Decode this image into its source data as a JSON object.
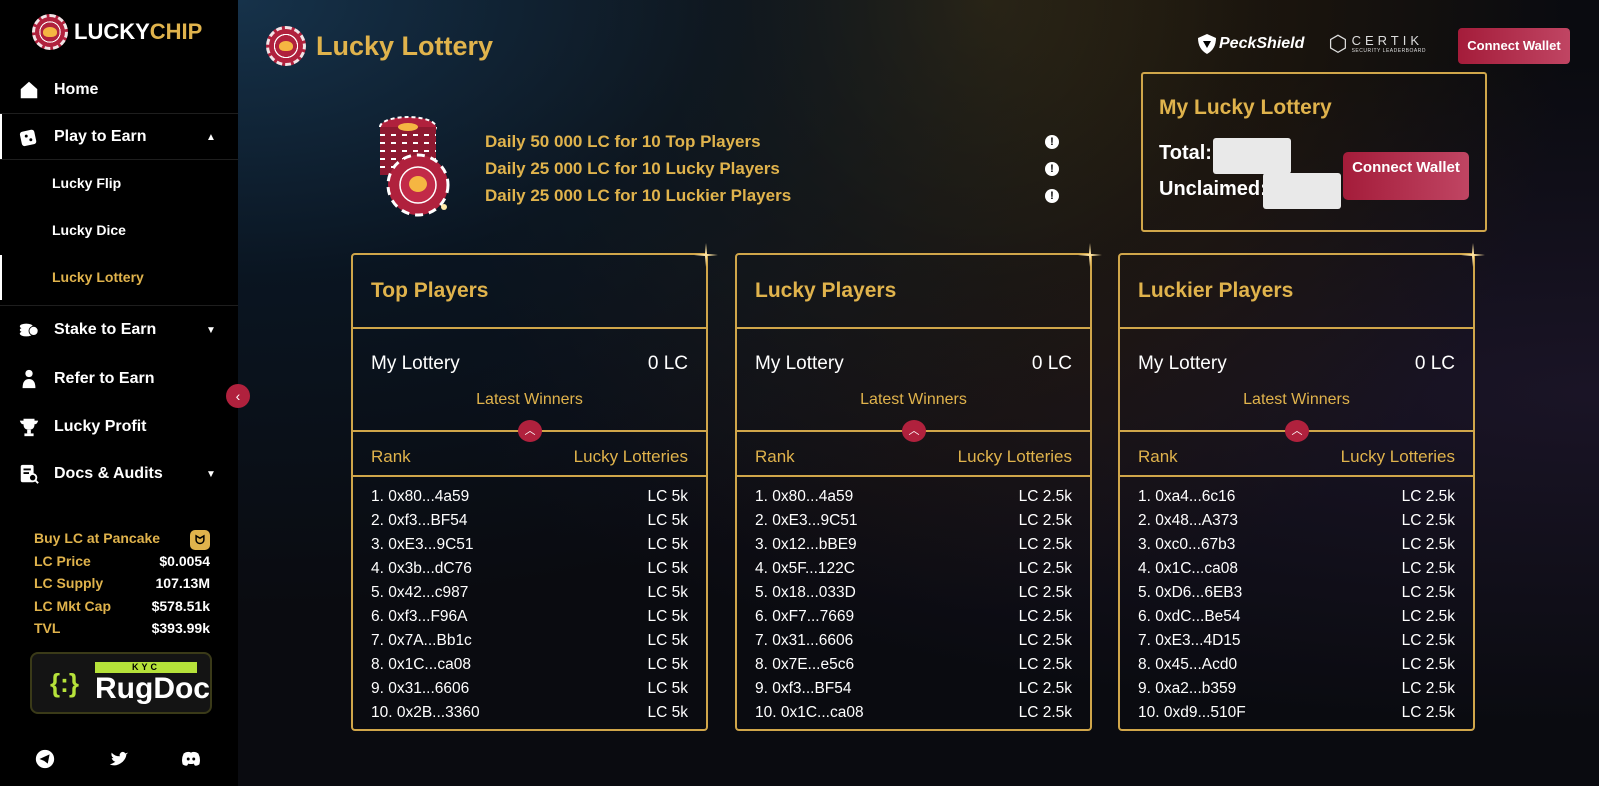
{
  "brand": {
    "name_white": "LUCKY",
    "name_gold": "CHIP"
  },
  "sidebar": {
    "items": [
      {
        "label": "Home",
        "icon": "home-icon"
      },
      {
        "label": "Play to Earn",
        "icon": "dice-icon"
      },
      {
        "label": "Stake to Earn",
        "icon": "coins-icon"
      },
      {
        "label": "Refer to Earn",
        "icon": "user-icon"
      },
      {
        "label": "Lucky Profit",
        "icon": "trophy-icon"
      },
      {
        "label": "Docs & Audits",
        "icon": "document-search-icon"
      }
    ],
    "sub_items": [
      "Lucky Flip",
      "Lucky Dice",
      "Lucky Lottery"
    ],
    "stats": {
      "buy_label": "Buy LC at Pancake",
      "price_label": "LC Price",
      "price_value": "$0.0054",
      "supply_label": "LC Supply",
      "supply_value": "107.13M",
      "mktcap_label": "LC Mkt Cap",
      "mktcap_value": "$578.51k",
      "tvl_label": "TVL",
      "tvl_value": "$393.99k"
    },
    "rugdoc": {
      "kyc": "KYC",
      "name": "RugDoc"
    }
  },
  "header": {
    "title": "Lucky Lottery",
    "peckshield": "PeckShield",
    "certik": "CERTIK",
    "certik_sub": "SECURITY LEADERBOARD",
    "connect_label": "Connect Wallet"
  },
  "hero": {
    "lines": [
      "Daily 50 000 LC for 10 Top Players",
      "Daily 25 000 LC for 10 Lucky Players",
      "Daily 25 000 LC for 10 Luckier Players"
    ]
  },
  "my_panel": {
    "title": "My Lucky Lottery",
    "total_label": "Total:",
    "unclaimed_label": "Unclaimed:",
    "connect_label": "Connect Wallet"
  },
  "cards": [
    {
      "title": "Top Players",
      "my_label": "My Lottery",
      "my_value": "0 LC",
      "latest": "Latest Winners",
      "rank_header": "Rank",
      "value_header": "Lucky Lotteries",
      "rows": [
        [
          "1. 0x80...4a59",
          "LC 5k"
        ],
        [
          "2. 0xf3...BF54",
          "LC 5k"
        ],
        [
          "3. 0xE3...9C51",
          "LC 5k"
        ],
        [
          "4. 0x3b...dC76",
          "LC 5k"
        ],
        [
          "5. 0x42...c987",
          "LC 5k"
        ],
        [
          "6. 0xf3...F96A",
          "LC 5k"
        ],
        [
          "7. 0x7A...Bb1c",
          "LC 5k"
        ],
        [
          "8. 0x1C...ca08",
          "LC 5k"
        ],
        [
          "9. 0x31...6606",
          "LC 5k"
        ],
        [
          "10. 0x2B...3360",
          "LC 5k"
        ]
      ]
    },
    {
      "title": "Lucky Players",
      "my_label": "My Lottery",
      "my_value": "0 LC",
      "latest": "Latest Winners",
      "rank_header": "Rank",
      "value_header": "Lucky Lotteries",
      "rows": [
        [
          "1. 0x80...4a59",
          "LC 2.5k"
        ],
        [
          "2. 0xE3...9C51",
          "LC 2.5k"
        ],
        [
          "3. 0x12...bBE9",
          "LC 2.5k"
        ],
        [
          "4. 0x5F...122C",
          "LC 2.5k"
        ],
        [
          "5. 0x18...033D",
          "LC 2.5k"
        ],
        [
          "6. 0xF7...7669",
          "LC 2.5k"
        ],
        [
          "7. 0x31...6606",
          "LC 2.5k"
        ],
        [
          "8. 0x7E...e5c6",
          "LC 2.5k"
        ],
        [
          "9. 0xf3...BF54",
          "LC 2.5k"
        ],
        [
          "10. 0x1C...ca08",
          "LC 2.5k"
        ]
      ]
    },
    {
      "title": "Luckier Players",
      "my_label": "My Lottery",
      "my_value": "0 LC",
      "latest": "Latest Winners",
      "rank_header": "Rank",
      "value_header": "Lucky Lotteries",
      "rows": [
        [
          "1. 0xa4...6c16",
          "LC 2.5k"
        ],
        [
          "2. 0x48...A373",
          "LC 2.5k"
        ],
        [
          "3. 0xc0...67b3",
          "LC 2.5k"
        ],
        [
          "4. 0x1C...ca08",
          "LC 2.5k"
        ],
        [
          "5. 0xD6...6EB3",
          "LC 2.5k"
        ],
        [
          "6. 0xdC...Be54",
          "LC 2.5k"
        ],
        [
          "7. 0xE3...4D15",
          "LC 2.5k"
        ],
        [
          "8. 0x45...Acd0",
          "LC 2.5k"
        ],
        [
          "9. 0xa2...b359",
          "LC 2.5k"
        ],
        [
          "10. 0xd9...510F",
          "LC 2.5k"
        ]
      ]
    }
  ],
  "colors": {
    "gold": "#e0b34c",
    "crimson": "#b0213d",
    "border": "#d0a64a"
  }
}
